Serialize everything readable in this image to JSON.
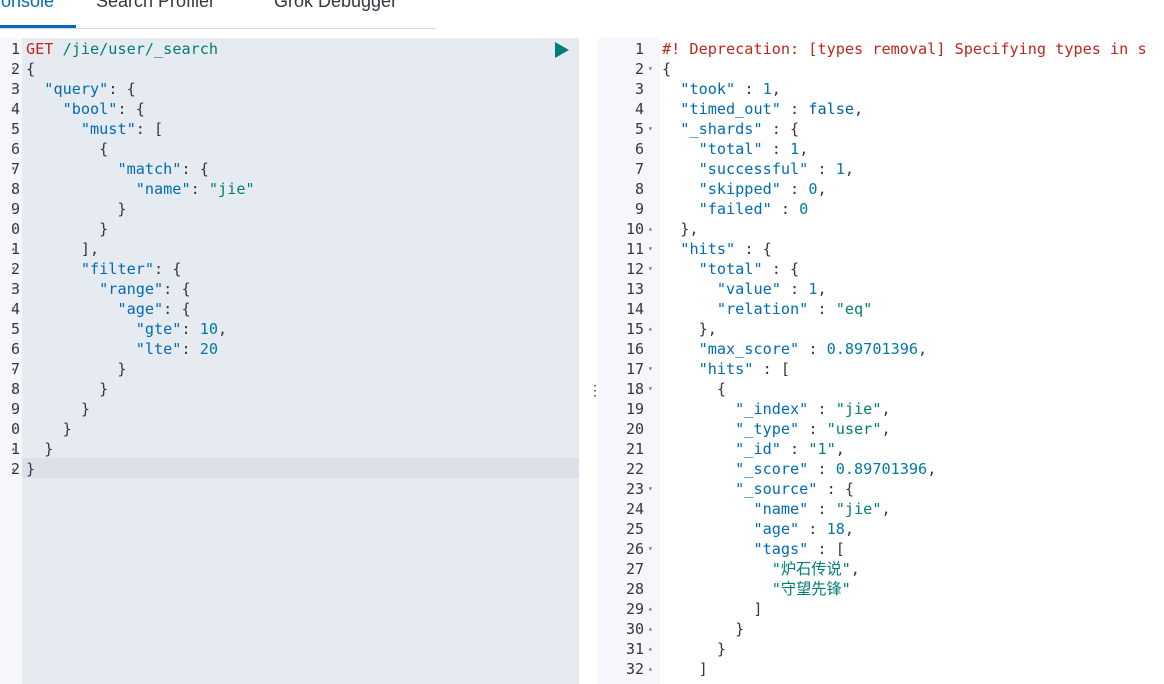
{
  "tabs": [
    {
      "label": "Console"
    },
    {
      "label": "Search Profiler"
    },
    {
      "label": "Grok Debugger"
    }
  ],
  "request": {
    "method": "GET",
    "path": "/jie/user/_search",
    "lines": [
      [
        [
          "m",
          "GET"
        ],
        [
          "p",
          " "
        ],
        [
          "u",
          "/jie/user/_search"
        ]
      ],
      [
        [
          "p",
          "{"
        ]
      ],
      [
        [
          "p",
          "  "
        ],
        [
          "k",
          "\"query\""
        ],
        [
          "p",
          ": {"
        ]
      ],
      [
        [
          "p",
          "    "
        ],
        [
          "k",
          "\"bool\""
        ],
        [
          "p",
          ": {"
        ]
      ],
      [
        [
          "p",
          "      "
        ],
        [
          "k",
          "\"must\""
        ],
        [
          "p",
          ": ["
        ]
      ],
      [
        [
          "p",
          "        {"
        ]
      ],
      [
        [
          "p",
          "          "
        ],
        [
          "k",
          "\"match\""
        ],
        [
          "p",
          ": {"
        ]
      ],
      [
        [
          "p",
          "            "
        ],
        [
          "k",
          "\"name\""
        ],
        [
          "p",
          ": "
        ],
        [
          "s",
          "\"jie\""
        ]
      ],
      [
        [
          "p",
          "          }"
        ]
      ],
      [
        [
          "p",
          "        }"
        ]
      ],
      [
        [
          "p",
          "      ],"
        ]
      ],
      [
        [
          "p",
          "      "
        ],
        [
          "k",
          "\"filter\""
        ],
        [
          "p",
          ": {"
        ]
      ],
      [
        [
          "p",
          "        "
        ],
        [
          "k",
          "\"range\""
        ],
        [
          "p",
          ": {"
        ]
      ],
      [
        [
          "p",
          "          "
        ],
        [
          "k",
          "\"age\""
        ],
        [
          "p",
          ": {"
        ]
      ],
      [
        [
          "p",
          "            "
        ],
        [
          "k",
          "\"gte\""
        ],
        [
          "p",
          ": "
        ],
        [
          "n",
          "10"
        ],
        [
          "p",
          ","
        ]
      ],
      [
        [
          "p",
          "            "
        ],
        [
          "k",
          "\"lte\""
        ],
        [
          "p",
          ": "
        ],
        [
          "n",
          "20"
        ]
      ],
      [
        [
          "p",
          "          }"
        ]
      ],
      [
        [
          "p",
          "        }"
        ]
      ],
      [
        [
          "p",
          "      }"
        ]
      ],
      [
        [
          "p",
          "    }"
        ]
      ],
      [
        [
          "p",
          "  }"
        ]
      ],
      [
        [
          "p",
          "}"
        ]
      ]
    ],
    "gutter": [
      "1",
      "2",
      "3",
      "4",
      "5",
      "6",
      "7",
      "8",
      "9",
      "0",
      "1",
      "2",
      "3",
      "4",
      "5",
      "6",
      "7",
      "8",
      "9",
      "0",
      "1",
      "2"
    ],
    "folds": [
      "",
      "▾",
      "▾",
      "▾",
      "▾",
      "▾",
      "▾",
      "",
      "▴",
      "▴",
      "▴",
      "▾",
      "▾",
      "▾",
      "",
      "",
      "▴",
      "▴",
      "▴",
      "▴",
      "▴",
      "▴"
    ]
  },
  "response": {
    "lines": [
      [
        [
          "m",
          "#! Deprecation: [types removal] Specifying types in s"
        ]
      ],
      [
        [
          "p",
          "{"
        ]
      ],
      [
        [
          "p",
          "  "
        ],
        [
          "k",
          "\"took\""
        ],
        [
          "p",
          " : "
        ],
        [
          "n",
          "1"
        ],
        [
          "p",
          ","
        ]
      ],
      [
        [
          "p",
          "  "
        ],
        [
          "k",
          "\"timed_out\""
        ],
        [
          "p",
          " : "
        ],
        [
          "b",
          "false"
        ],
        [
          "p",
          ","
        ]
      ],
      [
        [
          "p",
          "  "
        ],
        [
          "k",
          "\"_shards\""
        ],
        [
          "p",
          " : {"
        ]
      ],
      [
        [
          "p",
          "    "
        ],
        [
          "k",
          "\"total\""
        ],
        [
          "p",
          " : "
        ],
        [
          "n",
          "1"
        ],
        [
          "p",
          ","
        ]
      ],
      [
        [
          "p",
          "    "
        ],
        [
          "k",
          "\"successful\""
        ],
        [
          "p",
          " : "
        ],
        [
          "n",
          "1"
        ],
        [
          "p",
          ","
        ]
      ],
      [
        [
          "p",
          "    "
        ],
        [
          "k",
          "\"skipped\""
        ],
        [
          "p",
          " : "
        ],
        [
          "n",
          "0"
        ],
        [
          "p",
          ","
        ]
      ],
      [
        [
          "p",
          "    "
        ],
        [
          "k",
          "\"failed\""
        ],
        [
          "p",
          " : "
        ],
        [
          "n",
          "0"
        ]
      ],
      [
        [
          "p",
          "  },"
        ]
      ],
      [
        [
          "p",
          "  "
        ],
        [
          "k",
          "\"hits\""
        ],
        [
          "p",
          " : {"
        ]
      ],
      [
        [
          "p",
          "    "
        ],
        [
          "k",
          "\"total\""
        ],
        [
          "p",
          " : {"
        ]
      ],
      [
        [
          "p",
          "      "
        ],
        [
          "k",
          "\"value\""
        ],
        [
          "p",
          " : "
        ],
        [
          "n",
          "1"
        ],
        [
          "p",
          ","
        ]
      ],
      [
        [
          "p",
          "      "
        ],
        [
          "k",
          "\"relation\""
        ],
        [
          "p",
          " : "
        ],
        [
          "s",
          "\"eq\""
        ]
      ],
      [
        [
          "p",
          "    },"
        ]
      ],
      [
        [
          "p",
          "    "
        ],
        [
          "k",
          "\"max_score\""
        ],
        [
          "p",
          " : "
        ],
        [
          "n",
          "0.89701396"
        ],
        [
          "p",
          ","
        ]
      ],
      [
        [
          "p",
          "    "
        ],
        [
          "k",
          "\"hits\""
        ],
        [
          "p",
          " : ["
        ]
      ],
      [
        [
          "p",
          "      {"
        ]
      ],
      [
        [
          "p",
          "        "
        ],
        [
          "k",
          "\"_index\""
        ],
        [
          "p",
          " : "
        ],
        [
          "s",
          "\"jie\""
        ],
        [
          "p",
          ","
        ]
      ],
      [
        [
          "p",
          "        "
        ],
        [
          "k",
          "\"_type\""
        ],
        [
          "p",
          " : "
        ],
        [
          "s",
          "\"user\""
        ],
        [
          "p",
          ","
        ]
      ],
      [
        [
          "p",
          "        "
        ],
        [
          "k",
          "\"_id\""
        ],
        [
          "p",
          " : "
        ],
        [
          "s",
          "\"1\""
        ],
        [
          "p",
          ","
        ]
      ],
      [
        [
          "p",
          "        "
        ],
        [
          "k",
          "\"_score\""
        ],
        [
          "p",
          " : "
        ],
        [
          "n",
          "0.89701396"
        ],
        [
          "p",
          ","
        ]
      ],
      [
        [
          "p",
          "        "
        ],
        [
          "k",
          "\"_source\""
        ],
        [
          "p",
          " : {"
        ]
      ],
      [
        [
          "p",
          "          "
        ],
        [
          "k",
          "\"name\""
        ],
        [
          "p",
          " : "
        ],
        [
          "s",
          "\"jie\""
        ],
        [
          "p",
          ","
        ]
      ],
      [
        [
          "p",
          "          "
        ],
        [
          "k",
          "\"age\""
        ],
        [
          "p",
          " : "
        ],
        [
          "n",
          "18"
        ],
        [
          "p",
          ","
        ]
      ],
      [
        [
          "p",
          "          "
        ],
        [
          "k",
          "\"tags\""
        ],
        [
          "p",
          " : ["
        ]
      ],
      [
        [
          "p",
          "            "
        ],
        [
          "s",
          "\"炉石传说\""
        ],
        [
          "p",
          ","
        ]
      ],
      [
        [
          "p",
          "            "
        ],
        [
          "s",
          "\"守望先锋\""
        ]
      ],
      [
        [
          "p",
          "          ]"
        ]
      ],
      [
        [
          "p",
          "        }"
        ]
      ],
      [
        [
          "p",
          "      }"
        ]
      ],
      [
        [
          "p",
          "    ]"
        ]
      ]
    ],
    "gutter": [
      "1",
      "2",
      "3",
      "4",
      "5",
      "6",
      "7",
      "8",
      "9",
      "10",
      "11",
      "12",
      "13",
      "14",
      "15",
      "16",
      "17",
      "18",
      "19",
      "20",
      "21",
      "22",
      "23",
      "24",
      "25",
      "26",
      "27",
      "28",
      "29",
      "30",
      "31",
      "32"
    ],
    "folds": [
      "",
      "▾",
      "",
      "",
      "▾",
      "",
      "",
      "",
      "",
      "▴",
      "▾",
      "▾",
      "",
      "",
      "▴",
      "",
      "▾",
      "▾",
      "",
      "",
      "",
      "",
      "▾",
      "",
      "",
      "▾",
      "",
      "",
      "▴",
      "▴",
      "▴",
      "▴"
    ]
  },
  "icons": {
    "run": "play-icon",
    "settings": "wrench-icon",
    "resize": "vertical-dots-icon"
  },
  "colors": {
    "accent": "#006bb4",
    "run": "#017d73",
    "request_bg": "#e6ebf2",
    "string": "#017d73",
    "deprecation": "#bd271e"
  }
}
